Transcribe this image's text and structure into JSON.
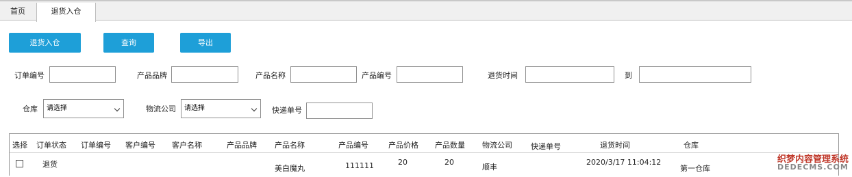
{
  "tabs": [
    {
      "label": "首页"
    },
    {
      "label": "退货入仓"
    }
  ],
  "toolbar": {
    "return_label": "退货入仓",
    "query_label": "查询",
    "export_label": "导出"
  },
  "filters": {
    "order_no_label": "订单编号",
    "order_no_value": "",
    "brand_label": "产品品牌",
    "brand_value": "",
    "product_name_label": "产品名称",
    "product_name_value": "",
    "product_no_label": "产品编号",
    "product_no_value": "",
    "return_time_label": "退货时间",
    "return_time_from": "",
    "to_label": "到",
    "return_time_to": "",
    "warehouse_label": "仓库",
    "warehouse_selected": "请选择",
    "logistics_label": "物流公司",
    "logistics_selected": "请选择",
    "tracking_label": "快递单号",
    "tracking_value": ""
  },
  "table": {
    "columns": [
      "选择",
      "订单状态",
      "订单编号",
      "客户编号",
      "客户名称",
      "产品品牌",
      "产品名称",
      "产品编号",
      "产品价格",
      "产品数量",
      "物流公司",
      "快递单号",
      "退货时间",
      "仓库"
    ],
    "rows": [
      {
        "selected": false,
        "status": "退货",
        "order_no": "",
        "customer_no": "",
        "customer_name": "",
        "brand": "",
        "product_name": "美白魔丸",
        "product_no": "111111",
        "price": "20",
        "quantity": "20",
        "logistics": "顺丰",
        "tracking_no": "",
        "return_time": "2020/3/17 11:04:12",
        "warehouse": "第一仓库"
      }
    ]
  },
  "watermark": {
    "line1": "织梦内容管理系统",
    "line2": "DEDECMS.COM"
  },
  "colors": {
    "button_bg": "#1e9fd8",
    "tab_bg": "#f0f0f0"
  }
}
